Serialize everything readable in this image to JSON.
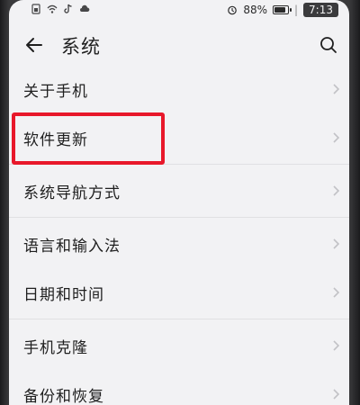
{
  "status_bar": {
    "battery": "88%",
    "battery_level": 0.88,
    "time": "7:13",
    "separator": "|",
    "icons": [
      "sim-icon",
      "wifi-icon",
      "tiktok-icon",
      "cloud-icon",
      "alarm-icon"
    ]
  },
  "header": {
    "back_icon": "back-arrow-icon",
    "title": "系统",
    "search_icon": "search-icon"
  },
  "menu": {
    "items": [
      {
        "label": "关于手机"
      },
      {
        "label": "软件更新"
      },
      {
        "label": "系统导航方式"
      },
      {
        "label": "语言和输入法"
      },
      {
        "label": "日期和时间"
      },
      {
        "label": "手机克隆"
      },
      {
        "label": "备份和恢复"
      }
    ],
    "chevron_icon": "chevron-right-icon"
  },
  "annotation": {
    "color": "#e8182a",
    "target": "软件更新"
  }
}
